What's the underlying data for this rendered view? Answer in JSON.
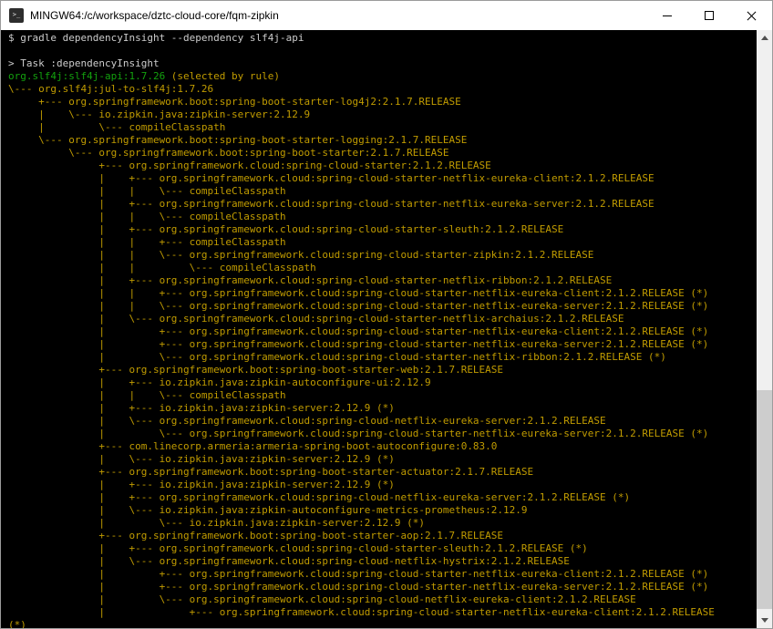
{
  "window": {
    "title": "MINGW64:/c/workspace/dztc-cloud-core/fqm-zipkin",
    "icon_glyph": ">_",
    "icons": {
      "app": "mintty-terminal-icon",
      "minimize": "minimize-icon",
      "maximize": "maximize-icon",
      "close": "close-icon",
      "scroll_up": "triangle-up-icon",
      "scroll_down": "triangle-down-icon"
    }
  },
  "terminal": {
    "colors": {
      "bg": "#000000",
      "fg": "#cccccc",
      "green": "#13a10e",
      "yellow": "#c19c00"
    },
    "command": "gradle dependencyInsight --dependency slf4j-api",
    "task": ":dependencyInsight",
    "selected_module": "org.slf4j:slf4j-api:1.7.26",
    "selection_reason": "(selected by rule)",
    "lines": [
      [
        [
          "w",
          "$ gradle dependencyInsight --dependency slf4j-api"
        ]
      ],
      [],
      [
        [
          "w",
          "> Task :dependencyInsight"
        ]
      ],
      [
        [
          "g",
          "org.slf4j:slf4j-api:1.7.26"
        ],
        [
          "y",
          " (selected by rule)"
        ]
      ],
      [
        [
          "y",
          "\\--- org.slf4j:jul-to-slf4j:1.7.26"
        ]
      ],
      [
        [
          "y",
          "     +--- org.springframework.boot:spring-boot-starter-log4j2:2.1.7.RELEASE"
        ]
      ],
      [
        [
          "y",
          "     |    \\--- io.zipkin.java:zipkin-server:2.12.9"
        ]
      ],
      [
        [
          "y",
          "     |         \\--- compileClasspath"
        ]
      ],
      [
        [
          "y",
          "     \\--- org.springframework.boot:spring-boot-starter-logging:2.1.7.RELEASE"
        ]
      ],
      [
        [
          "y",
          "          \\--- org.springframework.boot:spring-boot-starter:2.1.7.RELEASE"
        ]
      ],
      [
        [
          "y",
          "               +--- org.springframework.cloud:spring-cloud-starter:2.1.2.RELEASE"
        ]
      ],
      [
        [
          "y",
          "               |    +--- org.springframework.cloud:spring-cloud-starter-netflix-eureka-client:2.1.2.RELEASE"
        ]
      ],
      [
        [
          "y",
          "               |    |    \\--- compileClasspath"
        ]
      ],
      [
        [
          "y",
          "               |    +--- org.springframework.cloud:spring-cloud-starter-netflix-eureka-server:2.1.2.RELEASE"
        ]
      ],
      [
        [
          "y",
          "               |    |    \\--- compileClasspath"
        ]
      ],
      [
        [
          "y",
          "               |    +--- org.springframework.cloud:spring-cloud-starter-sleuth:2.1.2.RELEASE"
        ]
      ],
      [
        [
          "y",
          "               |    |    +--- compileClasspath"
        ]
      ],
      [
        [
          "y",
          "               |    |    \\--- org.springframework.cloud:spring-cloud-starter-zipkin:2.1.2.RELEASE"
        ]
      ],
      [
        [
          "y",
          "               |    |         \\--- compileClasspath"
        ]
      ],
      [
        [
          "y",
          "               |    +--- org.springframework.cloud:spring-cloud-starter-netflix-ribbon:2.1.2.RELEASE"
        ]
      ],
      [
        [
          "y",
          "               |    |    +--- org.springframework.cloud:spring-cloud-starter-netflix-eureka-client:2.1.2.RELEASE (*)"
        ]
      ],
      [
        [
          "y",
          "               |    |    \\--- org.springframework.cloud:spring-cloud-starter-netflix-eureka-server:2.1.2.RELEASE (*)"
        ]
      ],
      [
        [
          "y",
          "               |    \\--- org.springframework.cloud:spring-cloud-starter-netflix-archaius:2.1.2.RELEASE"
        ]
      ],
      [
        [
          "y",
          "               |         +--- org.springframework.cloud:spring-cloud-starter-netflix-eureka-client:2.1.2.RELEASE (*)"
        ]
      ],
      [
        [
          "y",
          "               |         +--- org.springframework.cloud:spring-cloud-starter-netflix-eureka-server:2.1.2.RELEASE (*)"
        ]
      ],
      [
        [
          "y",
          "               |         \\--- org.springframework.cloud:spring-cloud-starter-netflix-ribbon:2.1.2.RELEASE (*)"
        ]
      ],
      [
        [
          "y",
          "               +--- org.springframework.boot:spring-boot-starter-web:2.1.7.RELEASE"
        ]
      ],
      [
        [
          "y",
          "               |    +--- io.zipkin.java:zipkin-autoconfigure-ui:2.12.9"
        ]
      ],
      [
        [
          "y",
          "               |    |    \\--- compileClasspath"
        ]
      ],
      [
        [
          "y",
          "               |    +--- io.zipkin.java:zipkin-server:2.12.9 (*)"
        ]
      ],
      [
        [
          "y",
          "               |    \\--- org.springframework.cloud:spring-cloud-netflix-eureka-server:2.1.2.RELEASE"
        ]
      ],
      [
        [
          "y",
          "               |         \\--- org.springframework.cloud:spring-cloud-starter-netflix-eureka-server:2.1.2.RELEASE (*)"
        ]
      ],
      [
        [
          "y",
          "               +--- com.linecorp.armeria:armeria-spring-boot-autoconfigure:0.83.0"
        ]
      ],
      [
        [
          "y",
          "               |    \\--- io.zipkin.java:zipkin-server:2.12.9 (*)"
        ]
      ],
      [
        [
          "y",
          "               +--- org.springframework.boot:spring-boot-starter-actuator:2.1.7.RELEASE"
        ]
      ],
      [
        [
          "y",
          "               |    +--- io.zipkin.java:zipkin-server:2.12.9 (*)"
        ]
      ],
      [
        [
          "y",
          "               |    +--- org.springframework.cloud:spring-cloud-netflix-eureka-server:2.1.2.RELEASE (*)"
        ]
      ],
      [
        [
          "y",
          "               |    \\--- io.zipkin.java:zipkin-autoconfigure-metrics-prometheus:2.12.9"
        ]
      ],
      [
        [
          "y",
          "               |         \\--- io.zipkin.java:zipkin-server:2.12.9 (*)"
        ]
      ],
      [
        [
          "y",
          "               +--- org.springframework.boot:spring-boot-starter-aop:2.1.7.RELEASE"
        ]
      ],
      [
        [
          "y",
          "               |    +--- org.springframework.cloud:spring-cloud-starter-sleuth:2.1.2.RELEASE (*)"
        ]
      ],
      [
        [
          "y",
          "               |    \\--- org.springframework.cloud:spring-cloud-netflix-hystrix:2.1.2.RELEASE"
        ]
      ],
      [
        [
          "y",
          "               |         +--- org.springframework.cloud:spring-cloud-starter-netflix-eureka-client:2.1.2.RELEASE (*)"
        ]
      ],
      [
        [
          "y",
          "               |         +--- org.springframework.cloud:spring-cloud-starter-netflix-eureka-server:2.1.2.RELEASE (*)"
        ]
      ],
      [
        [
          "y",
          "               |         \\--- org.springframework.cloud:spring-cloud-netflix-eureka-client:2.1.2.RELEASE"
        ]
      ],
      [
        [
          "y",
          "               |              +--- org.springframework.cloud:spring-cloud-starter-netflix-eureka-client:2.1.2.RELEASE"
        ]
      ],
      [
        [
          "y",
          "(*)"
        ]
      ]
    ]
  }
}
